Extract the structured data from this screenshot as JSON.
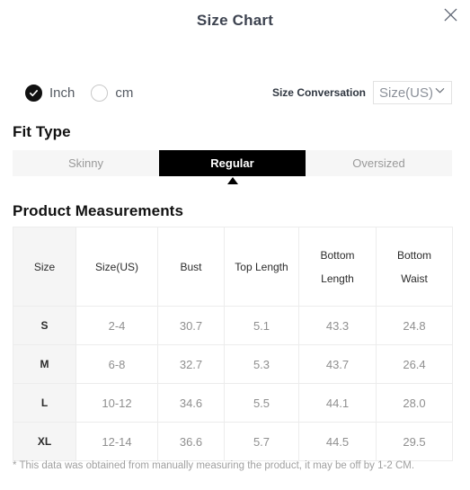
{
  "modal": {
    "title": "Size Chart",
    "close_icon": "close-icon"
  },
  "units": {
    "options": [
      {
        "label": "Inch",
        "selected": true
      },
      {
        "label": "cm",
        "selected": false
      }
    ]
  },
  "size_conversation": {
    "label": "Size Conversation",
    "selected_value": "Size(US)",
    "chevron_icon": "chevron-down-icon"
  },
  "fit_type": {
    "heading": "Fit Type",
    "tabs": [
      {
        "label": "Skinny",
        "active": false
      },
      {
        "label": "Regular",
        "active": true
      },
      {
        "label": "Oversized",
        "active": false
      }
    ]
  },
  "measurements": {
    "heading": "Product Measurements",
    "columns": [
      {
        "line1": "Size",
        "line2": ""
      },
      {
        "line1": "Size(US)",
        "line2": ""
      },
      {
        "line1": "Bust",
        "line2": ""
      },
      {
        "line1": "Top Length",
        "line2": ""
      },
      {
        "line1": "Bottom",
        "line2": "Length"
      },
      {
        "line1": "Bottom",
        "line2": "Waist"
      }
    ],
    "rows": [
      {
        "size": "S",
        "size_us": "2-4",
        "bust": "30.7",
        "top_length": "5.1",
        "bottom_length": "43.3",
        "bottom_waist": "24.8"
      },
      {
        "size": "M",
        "size_us": "6-8",
        "bust": "32.7",
        "top_length": "5.3",
        "bottom_length": "43.7",
        "bottom_waist": "26.4"
      },
      {
        "size": "L",
        "size_us": "10-12",
        "bust": "34.6",
        "top_length": "5.5",
        "bottom_length": "44.1",
        "bottom_waist": "28.0"
      },
      {
        "size": "XL",
        "size_us": "12-14",
        "bust": "36.6",
        "top_length": "5.7",
        "bottom_length": "44.5",
        "bottom_waist": "29.5"
      }
    ]
  },
  "footnote": "* This data was obtained from manually measuring the product, it may be off by 1-2 CM.",
  "colors": {
    "accent": "#000000",
    "title": "#3d4350",
    "muted_text": "#8f8f8f",
    "header_bg": "#f5f5f5",
    "border": "#ececec"
  }
}
